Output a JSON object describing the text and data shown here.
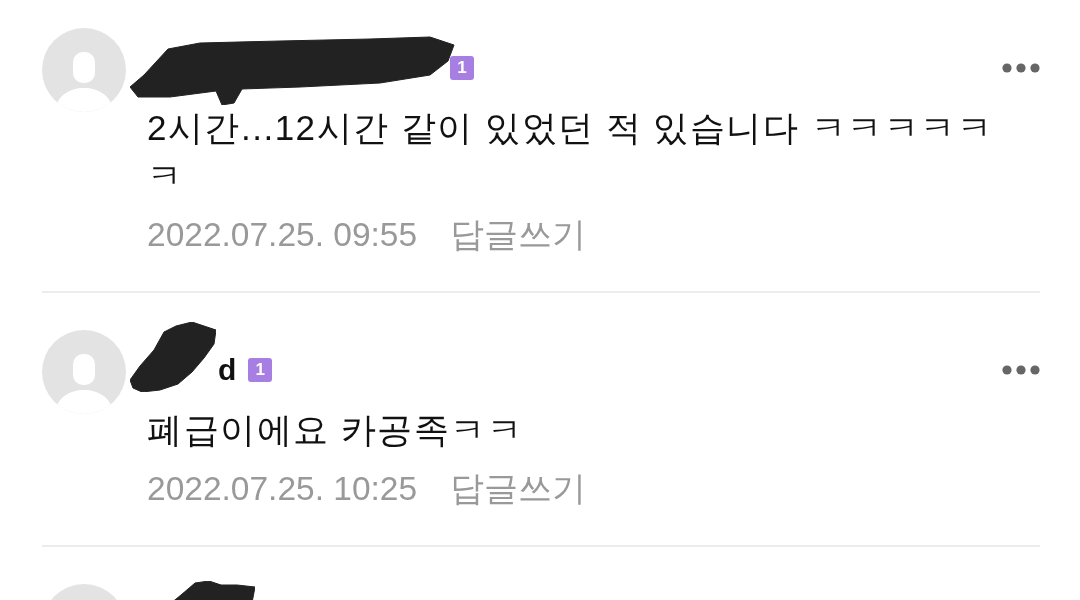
{
  "comments": [
    {
      "kind": "full",
      "name_redacted": true,
      "badge": "1",
      "text": "2시간...12시간 같이 있었던 적 있습니다 ㅋㅋㅋㅋㅋㅋ",
      "time": "2022.07.25. 09:55",
      "reply": "답글쓰기"
    },
    {
      "kind": "full",
      "name_redacted": true,
      "name": "d",
      "badge": "1",
      "text": "폐급이에요 카공족ㅋㅋ",
      "time": "2022.07.25. 10:25",
      "reply": "답글쓰기"
    },
    {
      "kind": "cut",
      "name_redacted": true
    }
  ]
}
